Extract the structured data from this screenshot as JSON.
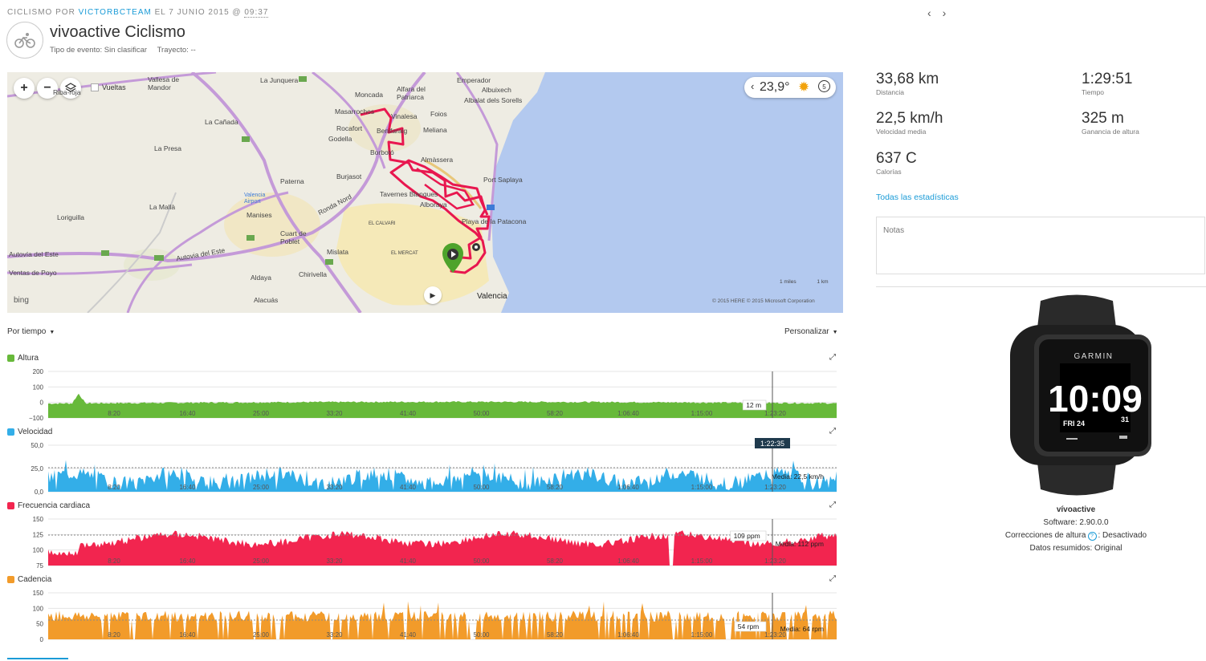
{
  "header": {
    "category": "CICLISMO POR",
    "user": "VICTORBCTEAM",
    "date_prefix": "EL 7 JUNIO 2015 @",
    "time": "09:37",
    "title": "vivoactive Ciclismo",
    "event_type": "Tipo de evento: Sin clasificar",
    "course": "Trayecto: --",
    "activity_icon": "bike-icon",
    "nav_prev": "‹",
    "nav_next": "›"
  },
  "map": {
    "zoom_in": "+",
    "zoom_out": "−",
    "laps_label": "Vueltas",
    "weather_temp": "23,9°",
    "weather_badge": "5",
    "brand": "bing",
    "copyright": "© 2015 HERE   © 2015 Microsoft Corporation",
    "scale_miles": "1 miles",
    "scale_km": "1 km",
    "places": [
      "La Junquera",
      "Vallesa de Mandor",
      "Riba-roja",
      "Emperador",
      "Albuixech",
      "Albalat dels Sorells",
      "Moncada",
      "Alfara del Patriarca",
      "Vinalesa",
      "Foios",
      "Meliana",
      "Masarrochos",
      "Rocafort",
      "Godella",
      "Benifaraig",
      "La Cañada",
      "La Presa",
      "Borbotó",
      "Almàssera",
      "Tavernes Blanques",
      "Alboraya",
      "Port Saplaya",
      "Paterna",
      "Burjasot",
      "Loriguilla",
      "La Mallà",
      "Valencia Airport",
      "Manises",
      "Cuart de Poblet",
      "Playa de la Patacona",
      "Ronda Nord",
      "Autovía del Este",
      "Autovia del Este",
      "Aldaya",
      "Ventas de Poyo",
      "Mislata",
      "Chirivella",
      "Alacuás",
      "Valencia",
      "EL CALVARI",
      "EL MERCAT"
    ]
  },
  "controls": {
    "x_axis_mode": "Por tiempo",
    "customize": "Personalizar"
  },
  "charts": [
    {
      "name": "Altura",
      "color": "#67b93a",
      "y_ticks": [
        "200",
        "100",
        "0",
        "−100"
      ],
      "tooltip": "12 m",
      "hover_time": "",
      "average": ""
    },
    {
      "name": "Velocidad",
      "color": "#33aee8",
      "y_ticks": [
        "50,0",
        "25,0",
        "0,0"
      ],
      "tooltip": "",
      "hover_time": "1:22:35",
      "average": "Media: 22,5 km/h"
    },
    {
      "name": "Frecuencia cardiaca",
      "color": "#f2254f",
      "y_ticks": [
        "150",
        "125",
        "100",
        "75"
      ],
      "tooltip": "109 ppm",
      "hover_time": "",
      "average": "Media: 112 ppm"
    },
    {
      "name": "Cadencia",
      "color": "#f29b2a",
      "y_ticks": [
        "150",
        "100",
        "50",
        "0"
      ],
      "tooltip": "54 rpm",
      "hover_time": "",
      "average": "Media: 64 rpm"
    }
  ],
  "x_ticks": [
    "8:20",
    "16:40",
    "25:00",
    "33:20",
    "41:40",
    "50:00",
    "58:20",
    "1:06:40",
    "1:15:00",
    "1:23:20"
  ],
  "stats": [
    {
      "value": "33,68 km",
      "label": "Distancia"
    },
    {
      "value": "1:29:51",
      "label": "Tiempo"
    },
    {
      "value": "22,5 km/h",
      "label": "Velocidad media"
    },
    {
      "value": "325 m",
      "label": "Ganancia de altura"
    },
    {
      "value": "637 C",
      "label": "Calorías"
    }
  ],
  "all_stats_link": "Todas las estadísticas",
  "notes_placeholder": "Notas",
  "device": {
    "name": "vívoactive",
    "software": "Software: 2.90.0.0",
    "elev_corr_label": "Correcciones de altura",
    "elev_corr_value": ": Desactivado",
    "summary": "Datos resumidos: Original",
    "watch_brand": "GARMIN",
    "watch_time": "10:09",
    "watch_day": "FRI 24",
    "watch_date": "31"
  },
  "colors": {
    "accent": "#1a9bd7",
    "route": "#e8174f"
  }
}
